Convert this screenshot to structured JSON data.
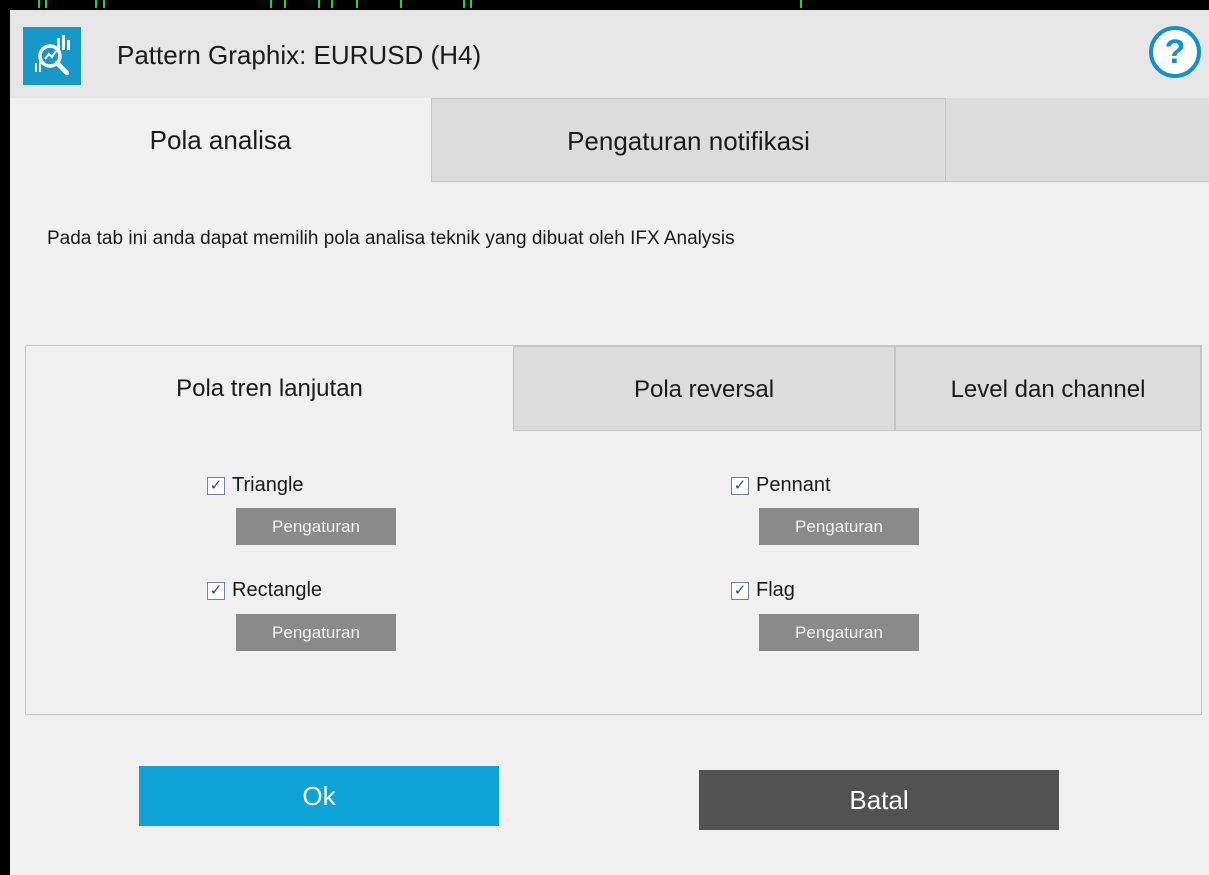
{
  "window": {
    "title": "Pattern Graphix: EURUSD (H4)",
    "app_icon": "pattern-analysis-icon",
    "help_icon": "help-icon",
    "help_label": "?"
  },
  "main_tabs": [
    {
      "label": "Pola analisa",
      "active": true
    },
    {
      "label": "Pengaturan notifikasi",
      "active": false
    }
  ],
  "description": "Pada tab ini anda dapat memilih pola analisa teknik yang dibuat oleh IFX Analysis",
  "sub_tabs": [
    {
      "label": "Pola tren lanjutan",
      "active": true
    },
    {
      "label": "Pola reversal",
      "active": false
    },
    {
      "label": "Level dan channel",
      "active": false
    }
  ],
  "patterns": [
    {
      "label": "Triangle",
      "checked": true,
      "settings_label": "Pengaturan"
    },
    {
      "label": "Pennant",
      "checked": true,
      "settings_label": "Pengaturan"
    },
    {
      "label": "Rectangle",
      "checked": true,
      "settings_label": "Pengaturan"
    },
    {
      "label": "Flag",
      "checked": true,
      "settings_label": "Pengaturan"
    }
  ],
  "checkmark": "✓",
  "buttons": {
    "ok": "Ok",
    "cancel": "Batal"
  },
  "colors": {
    "accent": "#0ea3d6",
    "help": "#1590cf",
    "cancel": "#525252",
    "settings_button": "#8a8a8a"
  }
}
